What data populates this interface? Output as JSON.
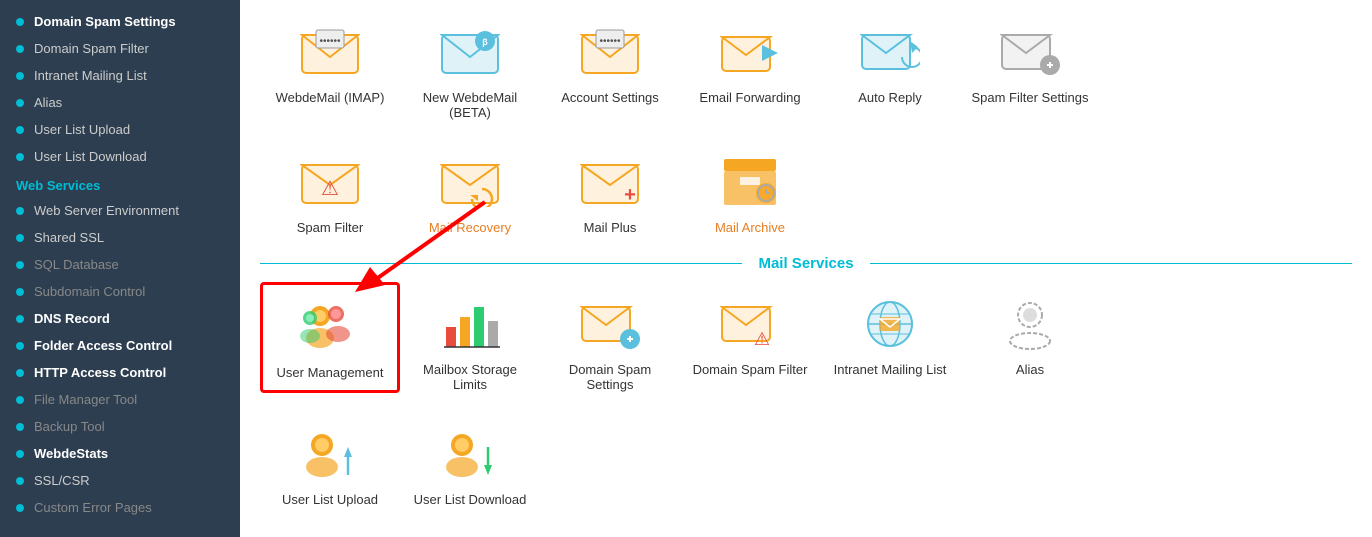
{
  "sidebar": {
    "section1_items": [
      {
        "label": "Domain Spam Settings",
        "bold": true
      },
      {
        "label": "Domain Spam Filter",
        "bold": false
      },
      {
        "label": "Intranet Mailing List",
        "bold": false
      },
      {
        "label": "Alias",
        "bold": false
      },
      {
        "label": "User List Upload",
        "bold": false
      },
      {
        "label": "User List Download",
        "bold": false
      }
    ],
    "section2_label": "Web Services",
    "section2_items": [
      {
        "label": "Web Server Environment",
        "bold": false,
        "dim": false
      },
      {
        "label": "Shared SSL",
        "bold": false,
        "dim": false
      },
      {
        "label": "SQL Database",
        "bold": false,
        "dim": true
      },
      {
        "label": "Subdomain Control",
        "bold": false,
        "dim": true
      },
      {
        "label": "DNS Record",
        "bold": true,
        "dim": false
      },
      {
        "label": "Folder Access Control",
        "bold": true,
        "dim": false
      },
      {
        "label": "HTTP Access Control",
        "bold": true,
        "dim": false
      },
      {
        "label": "File Manager Tool",
        "bold": false,
        "dim": true
      },
      {
        "label": "Backup Tool",
        "bold": false,
        "dim": true
      },
      {
        "label": "WebdeStats",
        "bold": true,
        "dim": false
      },
      {
        "label": "SSL/CSR",
        "bold": false,
        "dim": false
      },
      {
        "label": "Custom Error Pages",
        "bold": false,
        "dim": true
      }
    ]
  },
  "row1": [
    {
      "label": "WebdeMail (IMAP)",
      "icon_type": "password-envelope",
      "color": "normal"
    },
    {
      "label": "New WebdeMail (BETA)",
      "icon_type": "envelope-blue",
      "color": "normal"
    },
    {
      "label": "Account Settings",
      "icon_type": "password-envelope2",
      "color": "normal"
    },
    {
      "label": "Email Forwarding",
      "icon_type": "envelope-arrow",
      "color": "normal"
    },
    {
      "label": "Auto Reply",
      "icon_type": "envelope-clock",
      "color": "normal"
    },
    {
      "label": "Spam Filter Settings",
      "icon_type": "envelope-gear",
      "color": "normal"
    }
  ],
  "row2": [
    {
      "label": "Spam Filter",
      "icon_type": "envelope-warning",
      "color": "normal"
    },
    {
      "label": "Mail Recovery",
      "icon_type": "envelope-recover",
      "color": "orange"
    },
    {
      "label": "Mail Plus",
      "icon_type": "envelope-plus",
      "color": "normal"
    },
    {
      "label": "Mail Archive",
      "icon_type": "archive-gear",
      "color": "normal"
    }
  ],
  "mail_services_label": "Mail Services",
  "row3": [
    {
      "label": "User Management",
      "icon_type": "users",
      "color": "normal",
      "highlighted": true
    },
    {
      "label": "Mailbox Storage Limits",
      "icon_type": "bar-chart",
      "color": "normal"
    },
    {
      "label": "Domain Spam Settings",
      "icon_type": "envelope-gear2",
      "color": "normal"
    },
    {
      "label": "Domain Spam Filter",
      "icon_type": "envelope-warning2",
      "color": "normal"
    },
    {
      "label": "Intranet Mailing List",
      "icon_type": "globe-envelope",
      "color": "normal"
    },
    {
      "label": "Alias",
      "icon_type": "person-outline",
      "color": "normal"
    }
  ],
  "row4": [
    {
      "label": "User List Upload",
      "icon_type": "user-upload",
      "color": "normal"
    },
    {
      "label": "User List Download",
      "icon_type": "user-download",
      "color": "normal"
    }
  ]
}
